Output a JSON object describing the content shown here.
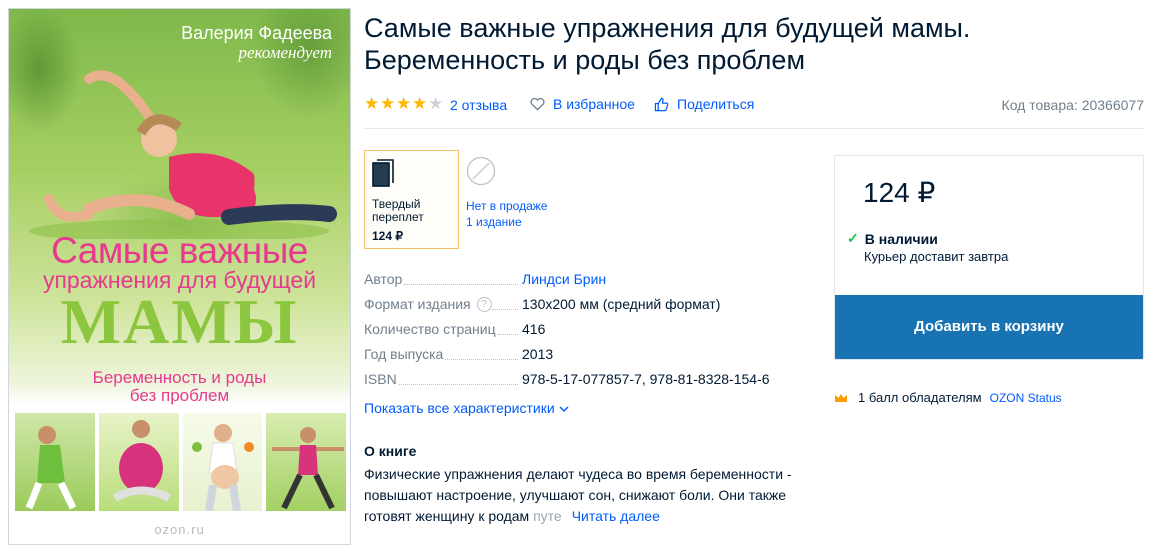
{
  "cover": {
    "author_line": "Валерия Фадеева",
    "recommends": "рекомендует",
    "title_line1": "Самые важные",
    "title_line2": "упражнения для будущей",
    "title_line3": "МАМЫ",
    "subtitle_line1": "Беременность и роды",
    "subtitle_line2": "без проблем",
    "watermark": "ozon.ru"
  },
  "product": {
    "title_line1": "Самые важные упражнения для будущей мамы.",
    "title_line2": "Беременность и роды без проблем",
    "rating": 4,
    "reviews": "2 отзыва",
    "favorite": "В избранное",
    "share": "Поделиться",
    "sku": "Код товара: 20366077"
  },
  "formats": {
    "selected": {
      "label_line1": "Твердый",
      "label_line2": "переплет",
      "price": "124 ₽"
    },
    "other": {
      "line1": "Нет в продаже",
      "line2": "1 издание"
    }
  },
  "specs": [
    {
      "key": "Автор",
      "value": "Линдси Брин",
      "link": true,
      "help": false
    },
    {
      "key": "Формат издания",
      "value": "130x200 мм (средний формат)",
      "link": false,
      "help": true
    },
    {
      "key": "Количество страниц",
      "value": "416",
      "link": false,
      "help": false
    },
    {
      "key": "Год выпуска",
      "value": "2013",
      "link": false,
      "help": false
    },
    {
      "key": "ISBN",
      "value": "978-5-17-077857-7, 978-81-8328-154-6",
      "link": false,
      "help": false
    }
  ],
  "show_all": "Показать все характеристики",
  "about": {
    "heading": "О книге",
    "text_line1": "Физические упражнения делают чудеса во время беременности -",
    "text_line2": "повышают настроение, улучшают сон, снижают боли. Они также",
    "text_line3": "готовят женщину к родам",
    "text_fade": "путе",
    "read_more": "Читать далее"
  },
  "buy": {
    "price": "124 ₽",
    "stock": "В наличии",
    "delivery": "Курьер доставит завтра",
    "cart_button": "Добавить в корзину",
    "bonus": "1 балл обладателям",
    "status": "OZON Status"
  },
  "colors": {
    "accent": "#005bff",
    "button": "#1873b3",
    "stars": "#ffb800",
    "in_stock": "#10c44c",
    "cover_pink": "#e8388f",
    "cover_green": "#8cc63f"
  }
}
